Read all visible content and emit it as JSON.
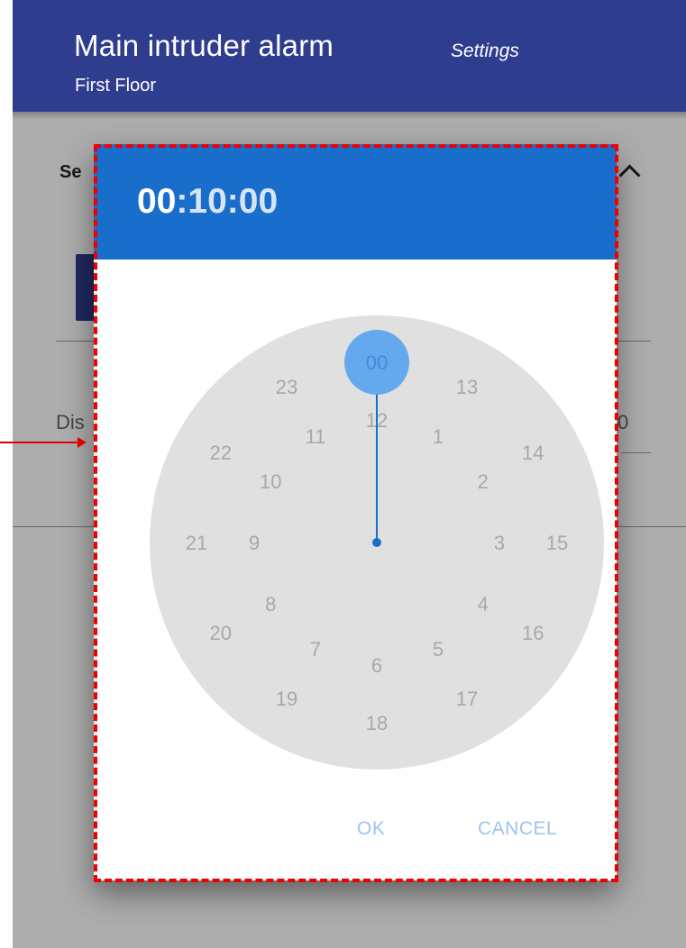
{
  "app_bar": {
    "title": "Main intruder alarm",
    "section": "Settings",
    "location": "First Floor",
    "color": "#2f3d8f"
  },
  "background_content": {
    "section_heading": "Se",
    "collapse_icon": "chevron-up-icon",
    "field_label": "Dis",
    "field_value": "0"
  },
  "time_picker": {
    "header": {
      "hours": "00",
      "minutes": ":10",
      "seconds": ":00",
      "color": "#1a6ecb"
    },
    "selected_hour": "00",
    "outer_ring": [
      "00",
      "13",
      "14",
      "15",
      "16",
      "17",
      "18",
      "19",
      "20",
      "21",
      "22",
      "23"
    ],
    "inner_ring": [
      "12",
      "1",
      "2",
      "3",
      "4",
      "5",
      "6",
      "7",
      "8",
      "9",
      "10",
      "11"
    ],
    "actions": {
      "ok": "OK",
      "cancel": "CANCEL"
    }
  },
  "annotation": {
    "highlight_color": "#ee0000",
    "highlight_style": "dashed-box",
    "pointer": "arrow-right-icon"
  }
}
